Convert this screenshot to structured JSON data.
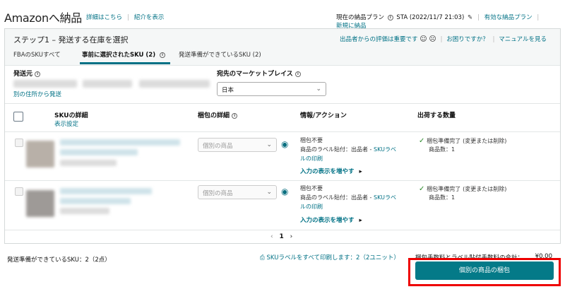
{
  "header": {
    "title": "Amazonへ納品",
    "details_link": "詳細はこちら",
    "sep": "|",
    "intro_link": "紹介を表示",
    "current_plan": "現在の納品プラン",
    "plan_value": "STA (2022/11/7 21:03)",
    "active_plans": "有効な納品プラン",
    "new_plan": "新規に納品"
  },
  "panel": {
    "step_title": "ステップ1 – 発送する在庫を選択",
    "feedback": "出品者からの評価は重要です",
    "help": "お困りですか？",
    "manual": "マニュアルを見る",
    "tabs": [
      {
        "label": "FBAのSKUすべて"
      },
      {
        "label": "事前に選択されたSKU (2)"
      },
      {
        "label": "発送準備ができているSKU (2)"
      }
    ]
  },
  "ship_from": {
    "label": "発送元",
    "change_link": "別の住所から発送"
  },
  "marketplace": {
    "label": "宛先のマーケットプレイス",
    "value": "日本"
  },
  "table": {
    "headers": {
      "sku": "SKUの詳細",
      "display_settings": "表示設定",
      "packing": "梱包の詳細",
      "info": "情報/アクション",
      "qty": "出荷する数量"
    },
    "rows": [
      {
        "packing_select": "個別の商品",
        "info_line1": "梱包不要",
        "info_line2_prefix": "商品のラベル貼付：出品者 - ",
        "info_line2_link": "SKUラベ",
        "info_line3_link": "ルの印刷",
        "more": "入力の表示を増やす",
        "status": "梱包準備完了",
        "change_link": "(変更または削除)",
        "count": "商品数：1"
      },
      {
        "packing_select": "個別の商品",
        "info_line1": "梱包不要",
        "info_line2_prefix": "商品のラベル貼付：出品者 - ",
        "info_line2_link": "SKUラベ",
        "info_line3_link": "ルの印刷",
        "more": "入力の表示を増やす",
        "status": "梱包準備完了",
        "change_link": "(変更または削除)",
        "count": "商品数：1"
      }
    ]
  },
  "pager": {
    "prev": "‹",
    "page": "1",
    "next": "›"
  },
  "footer": {
    "ready_skus": "発送準備ができているSKU：2（2点）",
    "print_all": "SKUラベルをすべて印刷します：2（2ユニット）",
    "fees_label": "梱包手数料とラベル貼付手数料の合計：",
    "fees_value": "¥0.00",
    "pack_button": "個別の商品の梱包"
  }
}
